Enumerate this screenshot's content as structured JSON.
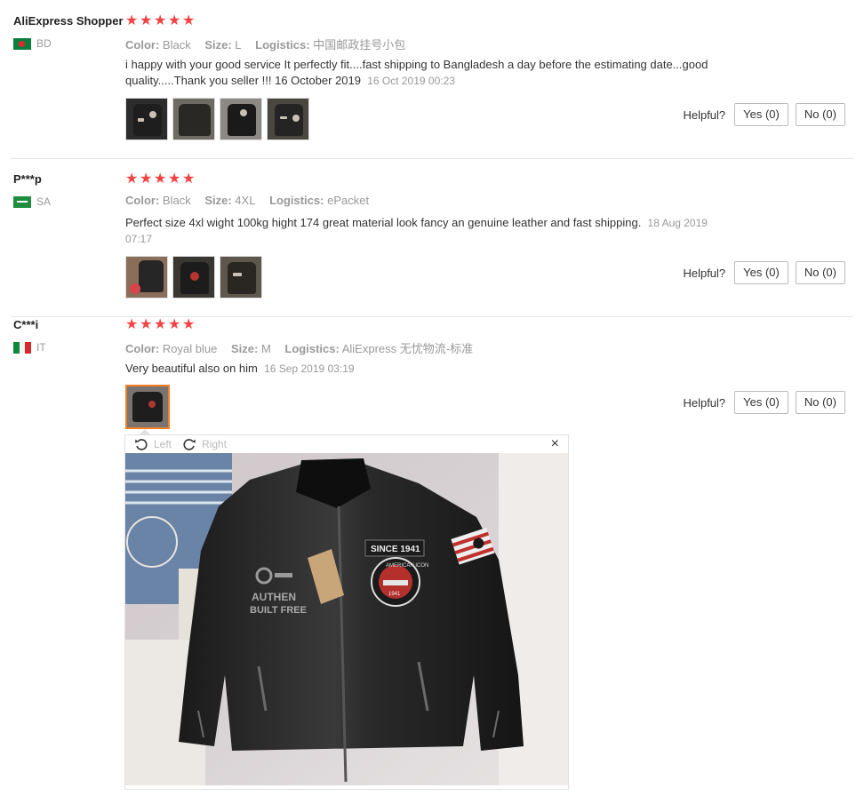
{
  "reviews": [
    {
      "user": "AliExpress Shopper",
      "country": "BD",
      "rating": 5,
      "attrs": [
        {
          "k": "Color:",
          "v": "Black"
        },
        {
          "k": "Size:",
          "v": "L"
        },
        {
          "k": "Logistics:",
          "v": "中国邮政挂号小包"
        }
      ],
      "text_line1": "i happy with your good service It perfectly fit....fast shipping to Bangladesh a day before the estimating date...good",
      "text_line2": "quality.....Thank you seller !!! 16 October 2019",
      "date": "16 Oct 2019 00:23",
      "images": 4
    },
    {
      "user": "P***p",
      "country": "SA",
      "rating": 5,
      "attrs": [
        {
          "k": "Color:",
          "v": "Black"
        },
        {
          "k": "Size:",
          "v": "4XL"
        },
        {
          "k": "Logistics:",
          "v": "ePacket"
        }
      ],
      "text": "Perfect size 4xl wight 100kg hight 174 great material look fancy an genuine leather and fast shipping.",
      "date_line1": "18 Aug 2019",
      "date_line2": "07:17",
      "images": 3
    },
    {
      "user": "C***i",
      "country": "IT",
      "rating": 5,
      "attrs": [
        {
          "k": "Color:",
          "v": "Royal blue"
        },
        {
          "k": "Size:",
          "v": "M"
        },
        {
          "k": "Logistics:",
          "v": "AliExpress 无忧物流-标准"
        }
      ],
      "text": "Very beautiful also on him",
      "date": "16 Sep 2019 03:19",
      "images": 1
    }
  ],
  "helpful": {
    "label": "Helpful?",
    "yes": "Yes (0)",
    "no": "No (0)"
  },
  "viewer": {
    "left": "Left",
    "right": "Right",
    "close": "×"
  },
  "jacket_patches": {
    "since": "SINCE 1941",
    "badge": "AMERICAN ICON",
    "year": "1941",
    "authentic": "AUTHEN",
    "built": "BUILT FREE"
  },
  "colors": {
    "star": "#f24242",
    "accent": "#f57f26"
  }
}
